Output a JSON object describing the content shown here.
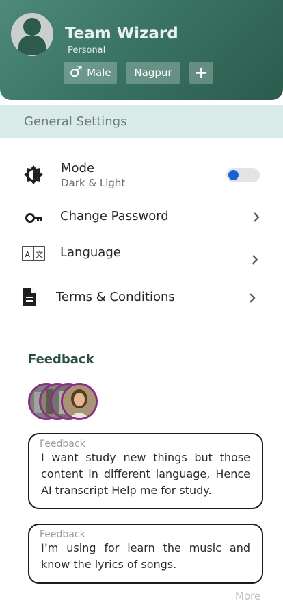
{
  "profile": {
    "name": "Team Wizard",
    "account_type": "Personal",
    "gender": "Male",
    "gender_symbol": "♂",
    "city": "Nagpur",
    "add_symbol": "+"
  },
  "section": {
    "title": "General Settings"
  },
  "settings": {
    "mode": {
      "label": "Mode",
      "sub": "Dark & Light",
      "enabled": true
    },
    "password": {
      "label": "Change Password"
    },
    "language": {
      "label": "Language"
    },
    "terms": {
      "label": "Terms & Conditions"
    }
  },
  "feedback": {
    "title": "Feedback",
    "items": [
      {
        "caption": "Feedback",
        "text": "I want study new things but those content in different language, Hence AI transcript Help me for study."
      },
      {
        "caption": "Feedback",
        "text": "I’m using for learn the music and know the lyrics of songs."
      }
    ],
    "more_label": "More"
  },
  "colors": {
    "header_start": "#4e8a79",
    "header_end": "#2b5c4d",
    "section_bg": "#d9ebe8",
    "toggle_knob": "#1565d8",
    "avatar_ring": "#8b2f86"
  },
  "icons": [
    "user-icon",
    "brightness-icon",
    "key-icon",
    "translate-icon",
    "document-icon",
    "chevron-right-icon"
  ]
}
